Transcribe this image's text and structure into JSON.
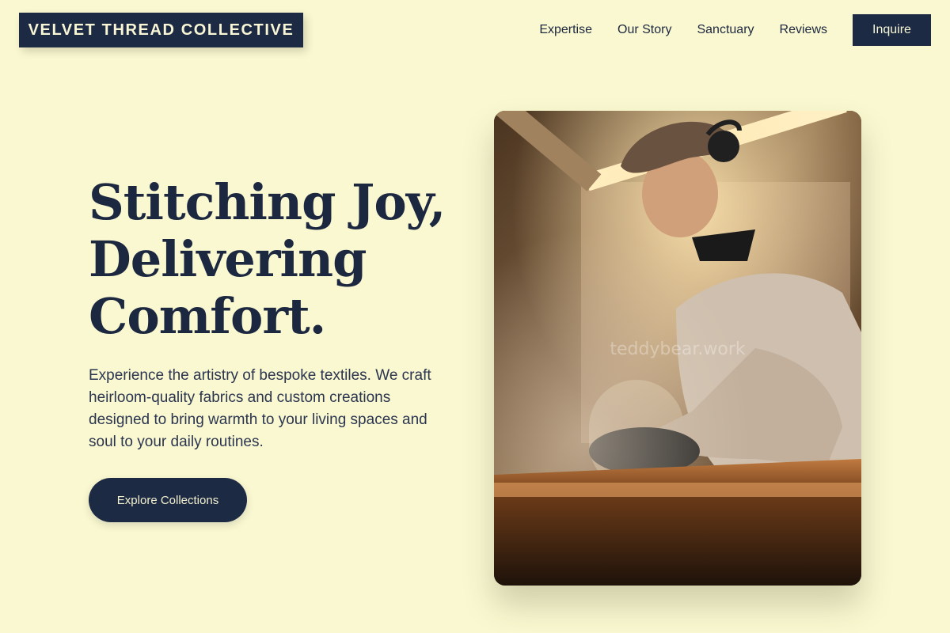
{
  "brand": {
    "name": "VELVET THREAD COLLECTIVE"
  },
  "nav": {
    "links": [
      "Expertise",
      "Our Story",
      "Sanctuary",
      "Reviews"
    ],
    "cta": "Inquire"
  },
  "hero": {
    "title_lines": [
      "Stitching Joy,",
      "Delivering",
      "Comfort."
    ],
    "description": "Experience the artistry of bespoke textiles. We craft heirloom-quality fabrics and custom creations designed to bring warmth to your living spaces and soul to your daily routines.",
    "button": "Explore Collections",
    "image": {
      "subject": "craftsman in flat cap and headphones working at a smoky workbench",
      "watermark": "teddybear.work"
    }
  },
  "colors": {
    "background": "#faf8d0",
    "navy": "#1d2a44",
    "text": "#1c2740"
  }
}
